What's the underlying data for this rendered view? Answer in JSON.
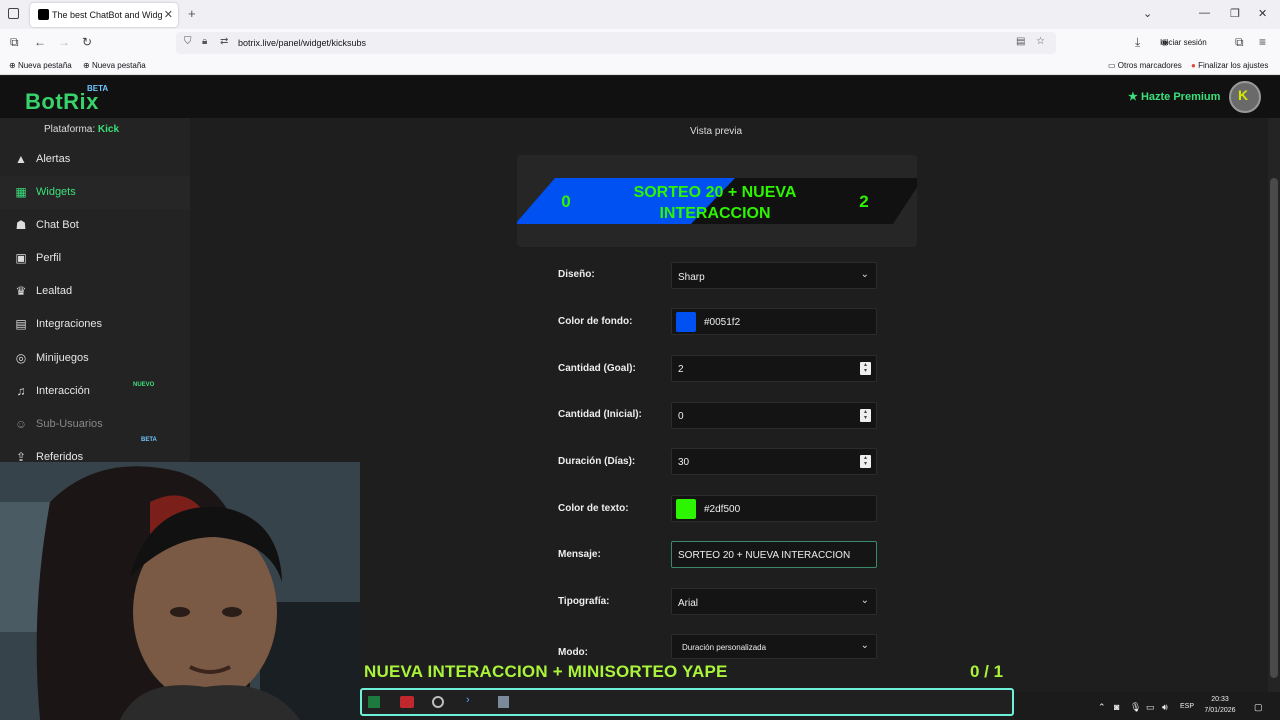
{
  "browser": {
    "tab_title": "The best ChatBot and Widgets",
    "url": "botrix.live/panel/widget/kicksubs",
    "signin": "Iniciar sesión",
    "bookmarks": {
      "new_tab_1": "Nueva pestaña",
      "new_tab_2": "Nueva pestaña",
      "other": "Otros marcadores",
      "finish_settings": "Finalizar los ajustes"
    }
  },
  "header": {
    "logo": "BotRix",
    "logo_badge": "BETA",
    "premium": "Hazte Premium",
    "avatar_letter": "K"
  },
  "sidebar": {
    "platform_label": "Plataforma:",
    "platform_value": "Kick",
    "items": [
      {
        "label": "Alertas",
        "icon": "warning-icon"
      },
      {
        "label": "Widgets",
        "icon": "grid-icon"
      },
      {
        "label": "Chat Bot",
        "icon": "robot-icon"
      },
      {
        "label": "Perfil",
        "icon": "id-card-icon"
      },
      {
        "label": "Lealtad",
        "icon": "trophy-icon"
      },
      {
        "label": "Integraciones",
        "icon": "terminal-icon"
      },
      {
        "label": "Minijuegos",
        "icon": "gamepad-icon"
      },
      {
        "label": "Interacción",
        "icon": "music-icon",
        "badge": "NUEVO"
      },
      {
        "label": "Sub-Usuarios",
        "icon": "users-icon"
      },
      {
        "label": "Referidos",
        "icon": "share-icon",
        "badge": "BETA"
      }
    ]
  },
  "preview": {
    "label": "Vista previa",
    "start": "0",
    "message": "SORTEO 20 + NUEVA INTERACCION",
    "goal": "2",
    "bg_color": "#0051f2",
    "text_color": "#2df500"
  },
  "form": {
    "design_label": "Diseño:",
    "design_value": "Sharp",
    "bg_label": "Color de fondo:",
    "bg_value": "#0051f2",
    "goal_label": "Cantidad (Goal):",
    "goal_value": "2",
    "initial_label": "Cantidad (Inicial):",
    "initial_value": "0",
    "duration_label": "Duración (Días):",
    "duration_value": "30",
    "text_color_label": "Color de texto:",
    "text_color_value": "#2df500",
    "message_label": "Mensaje:",
    "message_value": "SORTEO 20 + NUEVA INTERACCION",
    "font_label": "Tipografía:",
    "font_value": "Arial",
    "mode_label": "Modo:",
    "mode_value": "Duración personalizada"
  },
  "stream_overlay": {
    "text": "NUEVA INTERACCION + MINISORTEO YAPE",
    "count": "0 / 1"
  },
  "taskbar": {
    "lang": "ESP",
    "time": "20:33",
    "date": "7/01/2026"
  }
}
